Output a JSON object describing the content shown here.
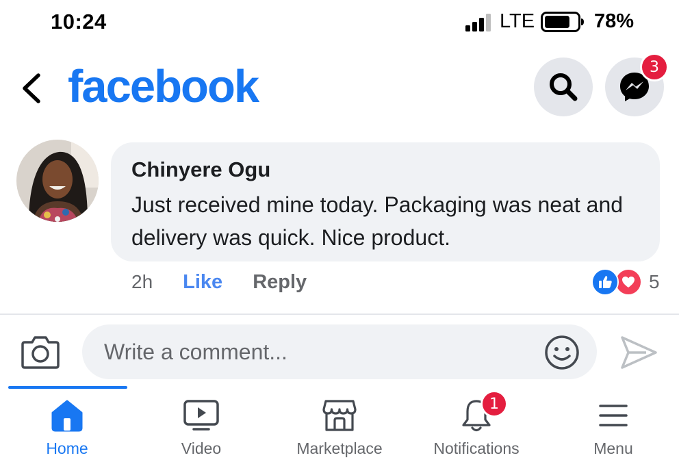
{
  "status_bar": {
    "time": "10:24",
    "network": "LTE",
    "battery": "78%",
    "battery_level": 0.78
  },
  "header": {
    "logo": "facebook",
    "messenger_badge": "3"
  },
  "comment": {
    "author": "Chinyere Ogu",
    "text": "Just received mine today. Packaging was neat and delivery was quick. Nice product.",
    "time": "2h",
    "like_label": "Like",
    "reply_label": "Reply",
    "reaction_count": "5",
    "reactions": [
      "like-icon",
      "love-icon"
    ]
  },
  "composer": {
    "placeholder": "Write a comment..."
  },
  "bottom_nav": {
    "items": [
      {
        "label": "Home",
        "icon": "home-icon",
        "active": true
      },
      {
        "label": "Video",
        "icon": "video-icon",
        "active": false
      },
      {
        "label": "Marketplace",
        "icon": "marketplace-icon",
        "active": false
      },
      {
        "label": "Notifications",
        "icon": "bell-icon",
        "active": false
      },
      {
        "label": "Menu",
        "icon": "menu-icon",
        "active": false
      }
    ],
    "notifications_badge": "1"
  },
  "colors": {
    "brand_blue": "#1877f2",
    "badge_red": "#e41e3f",
    "love_red": "#f33e58",
    "bubble_gray": "#f0f2f5",
    "secondary_text": "#65676b"
  }
}
